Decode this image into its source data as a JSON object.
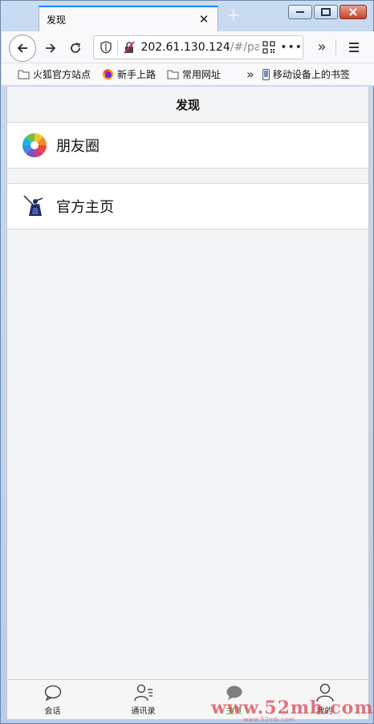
{
  "browser": {
    "tab_title": "发现",
    "url_host": "202.61.130.124",
    "url_path": "/#/page",
    "bookmarks": [
      {
        "label": "火狐官方站点",
        "icon": "folder-icon"
      },
      {
        "label": "新手上路",
        "icon": "firefox-icon"
      },
      {
        "label": "常用网址",
        "icon": "folder-icon"
      },
      {
        "label": "移动设备上的书签",
        "icon": "mobile-icon"
      }
    ]
  },
  "page": {
    "title": "发现",
    "items": [
      {
        "label": "朋友圈",
        "icon": "moments-icon"
      },
      {
        "label": "官方主页",
        "icon": "samurai-logo-icon"
      }
    ]
  },
  "tabbar": {
    "tabs": [
      {
        "label": "会话",
        "icon": "chat-bubble-icon",
        "active": false
      },
      {
        "label": "通讯录",
        "icon": "contacts-icon",
        "active": false
      },
      {
        "label": "主页",
        "icon": "home-bubble-icon",
        "active": true
      },
      {
        "label": "我的",
        "icon": "user-icon",
        "active": false
      }
    ]
  },
  "watermark": {
    "text": "www.52mb.com",
    "subtext": "www.52mb.com"
  },
  "colors": {
    "active_tab": "#1aad19",
    "accent": "#0a84ff"
  }
}
